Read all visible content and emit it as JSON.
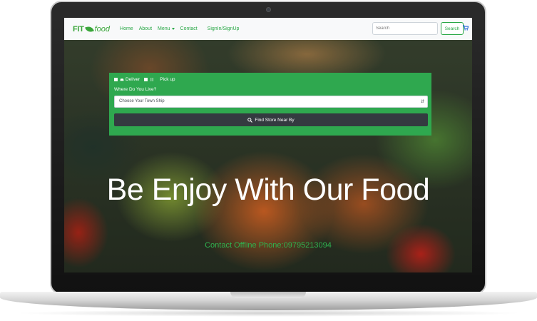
{
  "navbar": {
    "brand_fit": "FIT",
    "brand_food": "food",
    "links": {
      "home": "Home",
      "about": "About",
      "menu": "Menu",
      "contact": "Contact",
      "signin": "SignIn/SignUp"
    },
    "search_placeholder": "Search",
    "search_button": "Search",
    "cart_icon": "cart-icon"
  },
  "order_form": {
    "option_deliver": "Deliver",
    "option_pickup": "Pick up",
    "location_label": "Where Do You Live?",
    "township_select_value": "Choose Your Town Ship",
    "find_button": "Find Store Near By",
    "panel_color": "#2fa84f"
  },
  "hero": {
    "headline": "Be Enjoy With Our Food",
    "contact_line": "Contact Offline Phone:09795213094"
  },
  "colors": {
    "accent_green": "#28a745",
    "dark_button": "#343a40"
  }
}
